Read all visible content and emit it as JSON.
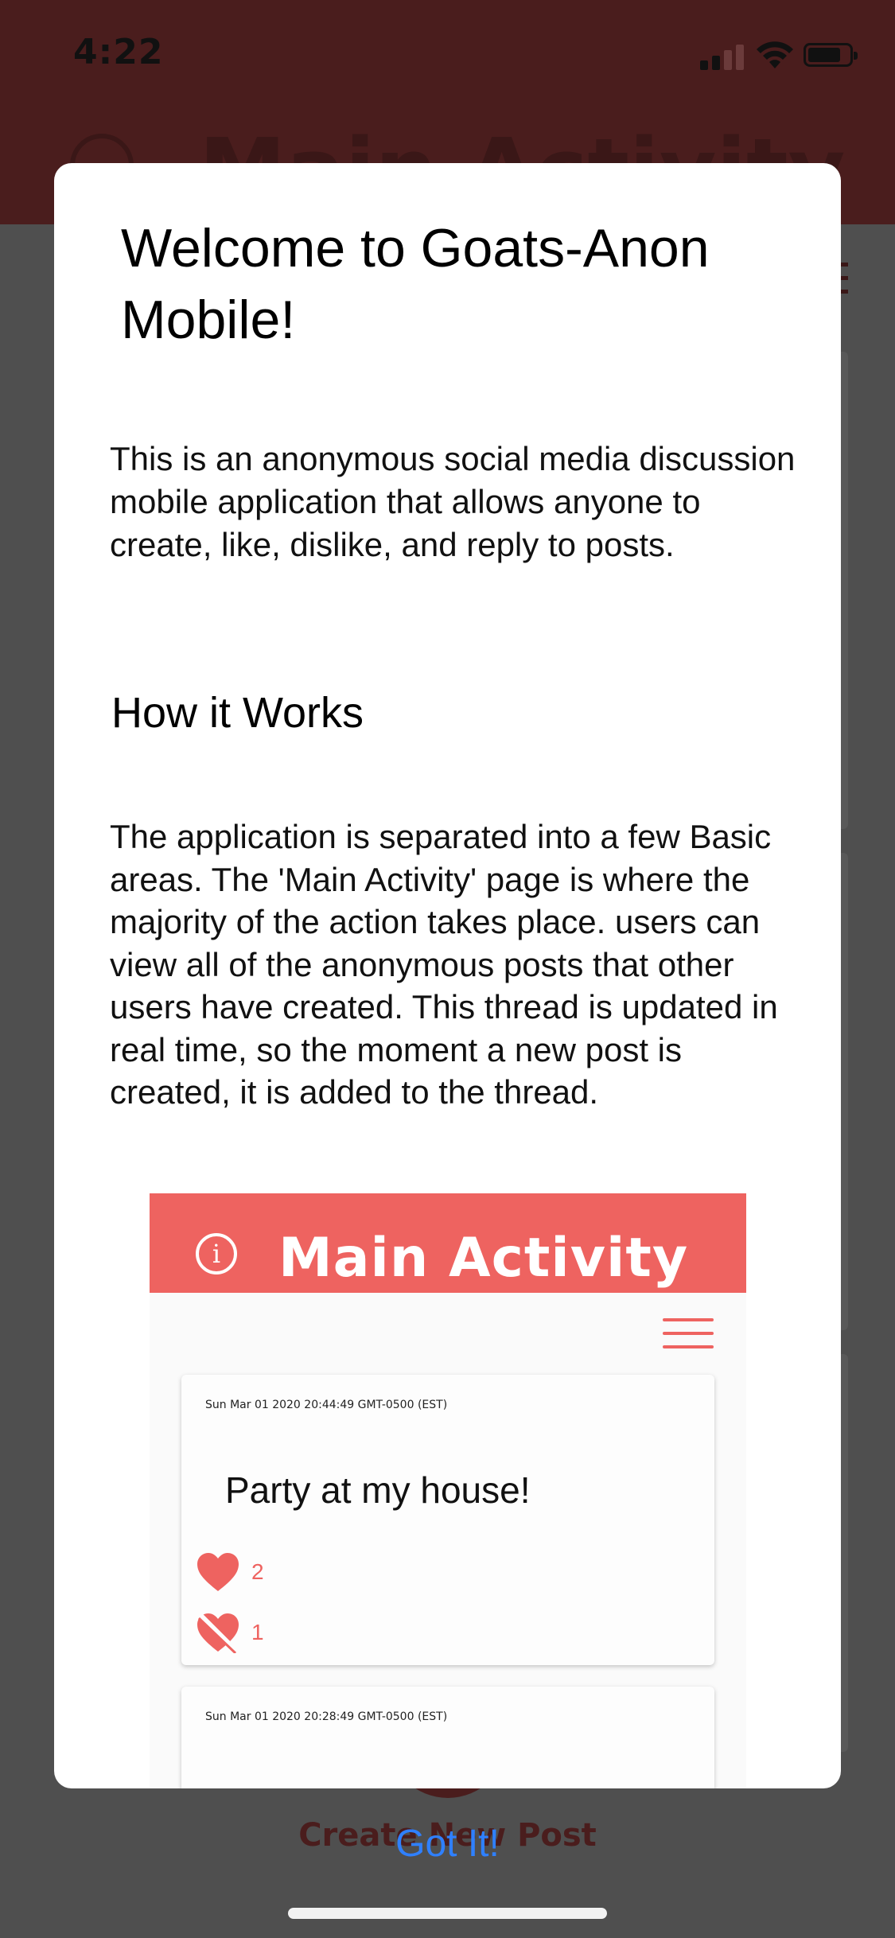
{
  "status_bar": {
    "time": "4:22"
  },
  "background": {
    "header_title": "Main Activity",
    "create_post_label": "Create New Post"
  },
  "modal": {
    "title": "Welcome to Goats-Anon Mobile!",
    "intro": "This is an anonymous social media discussion mobile application that allows anyone to create, like, dislike, and reply to posts.",
    "how_heading": "How it Works",
    "how_body": "The application is separated into a few Basic areas. The 'Main Activity' page is where the majority of the action takes place. users can view all of the anonymous posts that other users have created. This thread is updated in real time, so the moment a new post is created, it is added to the thread.",
    "screenshot": {
      "header_title": "Main Activity",
      "info_glyph": "i",
      "posts": [
        {
          "date": "Sun Mar 01 2020 20:44:49 GMT-0500 (EST)",
          "text": "Party at my house!",
          "likes": "2",
          "dislikes": "1"
        },
        {
          "date": "Sun Mar 01 2020 20:28:49 GMT-0500 (EST)"
        }
      ]
    }
  },
  "got_it_label": "Got It!",
  "colors": {
    "accent": "#ee6360",
    "link": "#2f80ff",
    "header_dim": "#4a1d1d"
  }
}
